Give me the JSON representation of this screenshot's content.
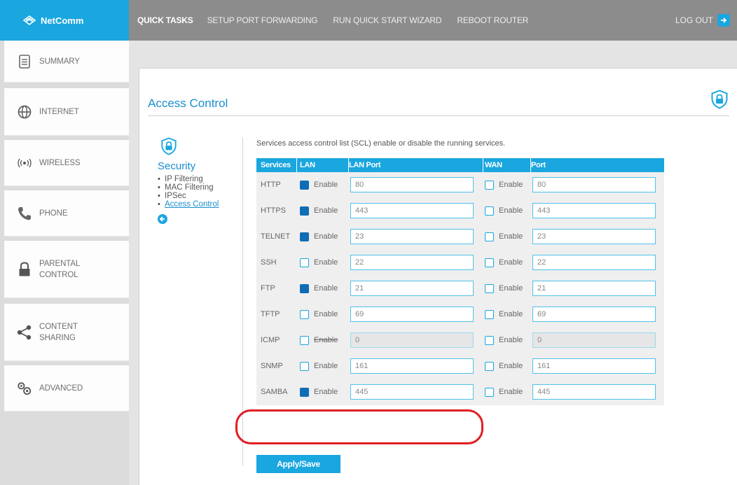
{
  "brand": {
    "name": "NetComm",
    "accent": "#1aa6df",
    "highlight": "#e01e24"
  },
  "topnav": {
    "items": [
      "QUICK TASKS",
      "SETUP PORT FORWARDING",
      "RUN QUICK START WIZARD",
      "REBOOT ROUTER"
    ],
    "logout": "LOG OUT"
  },
  "sidebar": {
    "items": [
      {
        "label": "SUMMARY",
        "icon": "document-icon"
      },
      {
        "label": "INTERNET",
        "icon": "globe-icon"
      },
      {
        "label": "WIRELESS",
        "icon": "wireless-icon"
      },
      {
        "label": "PHONE",
        "icon": "phone-icon"
      },
      {
        "label": "PARENTAL CONTROL",
        "icon": "lock-icon"
      },
      {
        "label": "CONTENT SHARING",
        "icon": "share-icon"
      },
      {
        "label": "ADVANCED",
        "icon": "gears-icon"
      }
    ]
  },
  "page": {
    "title": "Access Control",
    "description": "Services access control list (SCL) enable or disable the running services."
  },
  "subnav": {
    "title": "Security",
    "items": [
      "IP Filtering",
      "MAC Filtering",
      "IPSec",
      "Access Control"
    ]
  },
  "table": {
    "headers": [
      "Services",
      "LAN",
      "LAN Port",
      "WAN",
      "Port"
    ],
    "enable_label": "Enable",
    "rows": [
      {
        "service": "HTTP",
        "lan": true,
        "lan_port": "80",
        "wan": false,
        "wan_port": "80"
      },
      {
        "service": "HTTPS",
        "lan": true,
        "lan_port": "443",
        "wan": false,
        "wan_port": "443"
      },
      {
        "service": "TELNET",
        "lan": true,
        "lan_port": "23",
        "wan": false,
        "wan_port": "23"
      },
      {
        "service": "SSH",
        "lan": false,
        "lan_port": "22",
        "wan": false,
        "wan_port": "22"
      },
      {
        "service": "FTP",
        "lan": true,
        "lan_port": "21",
        "wan": false,
        "wan_port": "21"
      },
      {
        "service": "TFTP",
        "lan": false,
        "lan_port": "69",
        "wan": false,
        "wan_port": "69"
      },
      {
        "service": "ICMP",
        "lan": false,
        "lan_port": "0",
        "wan": false,
        "wan_port": "0"
      },
      {
        "service": "SNMP",
        "lan": false,
        "lan_port": "161",
        "wan": false,
        "wan_port": "161"
      },
      {
        "service": "SAMBA",
        "lan": true,
        "lan_port": "445",
        "wan": false,
        "wan_port": "445"
      }
    ]
  },
  "apply_label": "Apply/Save"
}
